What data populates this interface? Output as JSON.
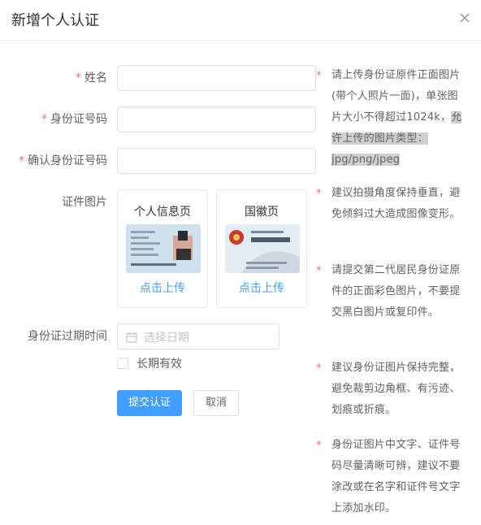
{
  "dialog": {
    "title": "新增个人认证",
    "close_icon": "close-icon"
  },
  "form": {
    "name_label": "姓名",
    "id_label": "身份证号码",
    "id_confirm_label": "确认身份证号码",
    "photo_label": "证件图片",
    "expire_label": "身份证过期时间",
    "name_value": "",
    "id_value": "",
    "id_confirm_value": "",
    "required_mark": "*"
  },
  "cards": [
    {
      "title": "个人信息页",
      "upload_label": "点击上传"
    },
    {
      "title": "国徽页",
      "upload_label": "点击上传"
    }
  ],
  "date": {
    "placeholder": "选择日期",
    "icon": "calendar-icon"
  },
  "long_term": {
    "label": "长期有效",
    "checked": false
  },
  "buttons": {
    "submit": "提交认证",
    "cancel": "取消"
  },
  "tips": {
    "t1_a": "请上传身份证原件正面图片(带个人照片一面)，单张图片大小不得超过1024k，",
    "t1_b": "允许上传的图片类型：jpg/png/jpeg",
    "t2": "建议拍摄角度保持垂直，避免倾斜过大造成图像变形。",
    "t3": "请提交第二代居民身份证原件的正面彩色图片，不要提交黑白图片或复印件。",
    "t4": "建议身份证图片保持完整，避免裁剪边角框、有污迹、划痕或折痕。",
    "t5": "身份证图片中文字、证件号码尽量清晰可辨，建议不要涂改或在名字和证件号文字上添加水印。"
  },
  "colors": {
    "primary": "#409eff",
    "required": "#f56c6c"
  }
}
